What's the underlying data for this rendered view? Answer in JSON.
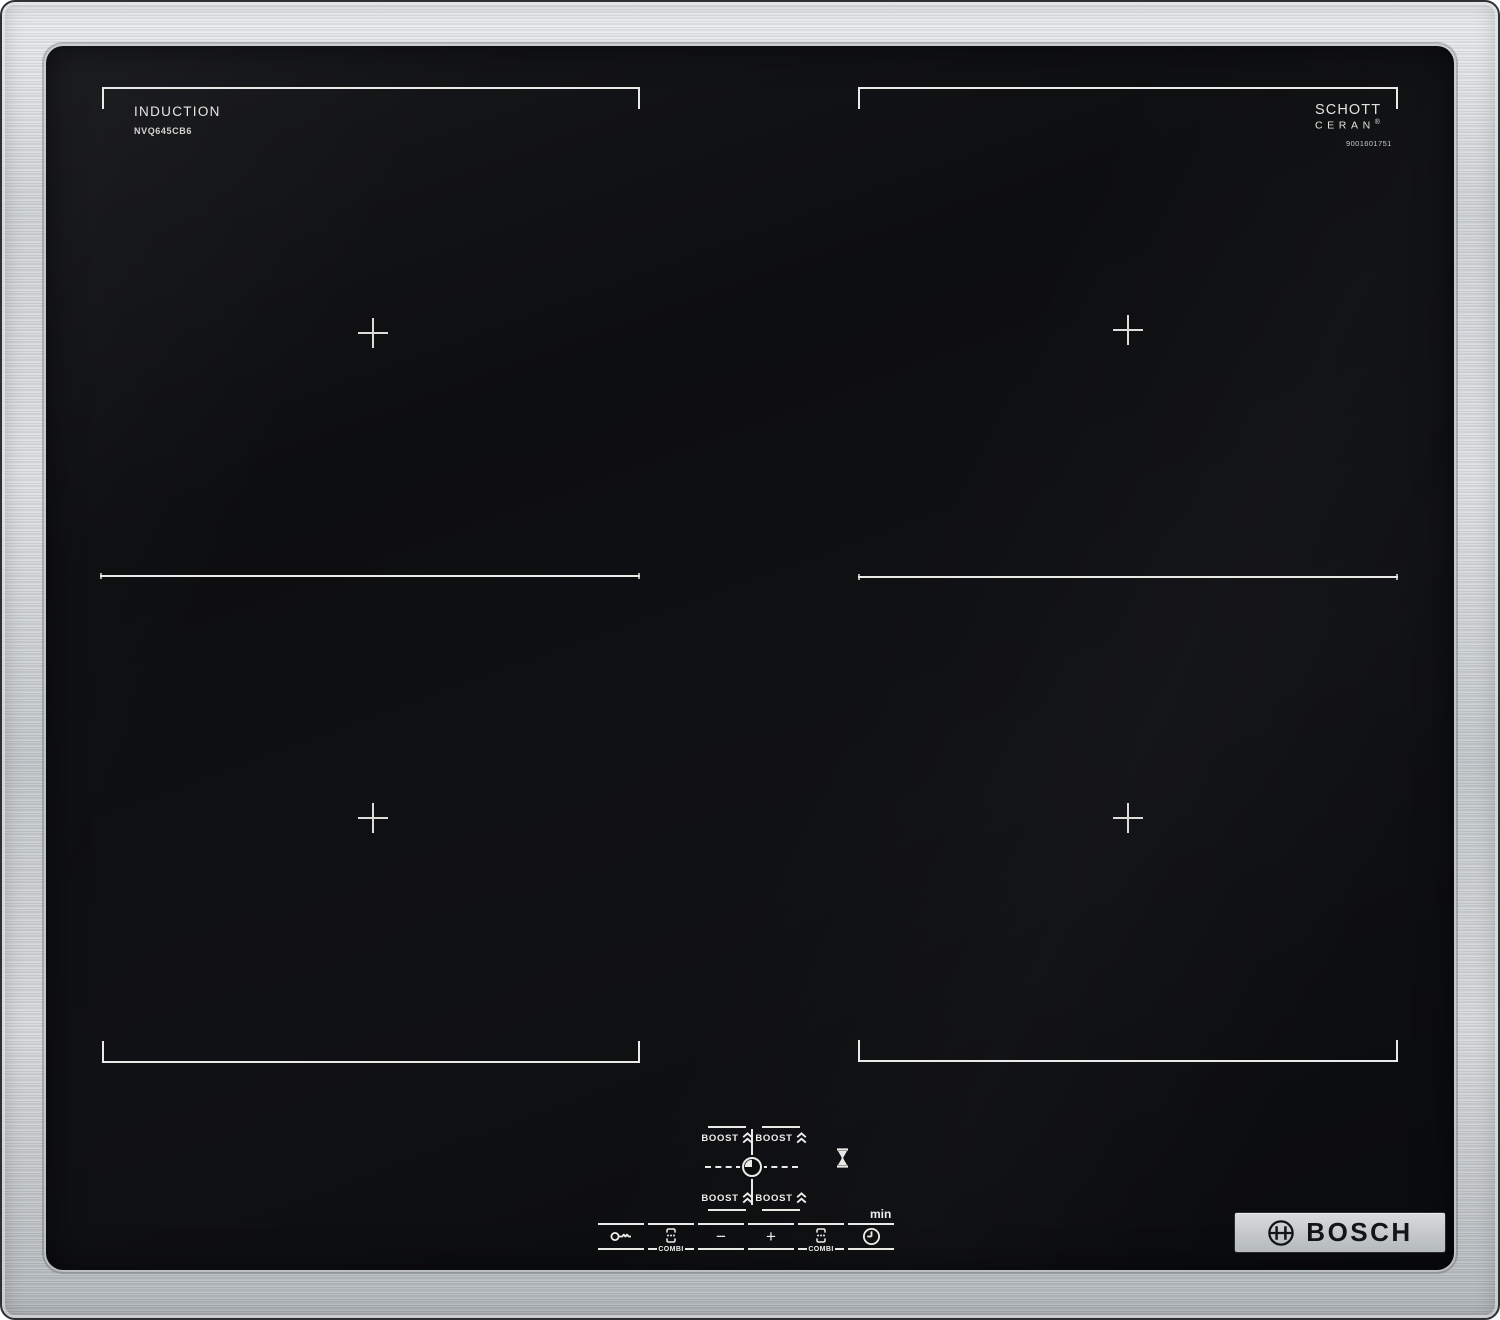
{
  "branding": {
    "zone_label": "INDUCTION",
    "model_number": "NVQ645CB6",
    "glass_brand_line1": "SCHOTT",
    "glass_brand_line2": "CERAN",
    "glass_brand_registered": "®",
    "part_number": "9001601751",
    "manufacturer": "BOSCH"
  },
  "controls": {
    "boost_label": "BOOST",
    "combi_label": "COMBI",
    "minus_label": "−",
    "plus_label": "+",
    "timer_unit_label": "min"
  },
  "icons": {
    "boost_chevrons": "double-chevron-up-icon",
    "center_timer": "timer-clock-icon",
    "hourglass": "hourglass-icon",
    "key_lock": "key-lock-icon",
    "combi_bridge": "combi-bridge-icon",
    "timer": "timer-clock-icon",
    "bosch_emblem": "bosch-armature-icon"
  },
  "colors": {
    "glass": "#0d0e10",
    "marking_white": "#e9e9e6",
    "steel_light": "#e9eced",
    "steel_dark": "#aeb3b7",
    "logo_plate": "#c3c7c9",
    "logo_text": "#121416"
  }
}
